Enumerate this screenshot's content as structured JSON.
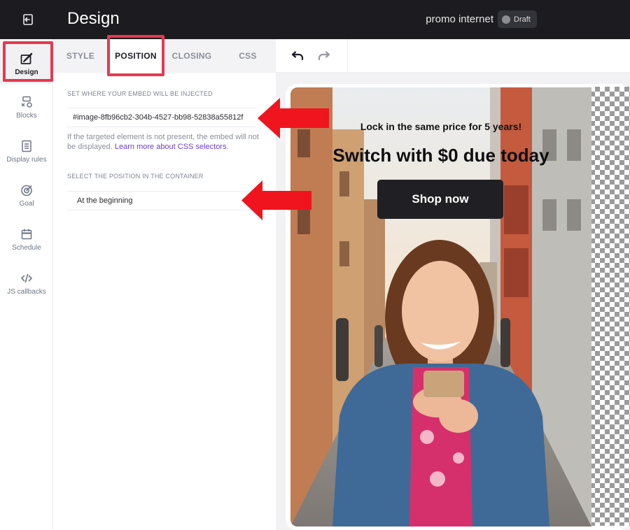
{
  "header": {
    "title": "Design",
    "campaign_name": "promo internet",
    "status_label": "Draft",
    "exit_icon": "exit-icon"
  },
  "sidebar": {
    "items": [
      {
        "label": "Design",
        "icon": "pen-icon",
        "active": true
      },
      {
        "label": "Blocks",
        "icon": "blocks-icon",
        "active": false
      },
      {
        "label": "Display rules",
        "icon": "document-icon",
        "active": false
      },
      {
        "label": "Goal",
        "icon": "target-icon",
        "active": false
      },
      {
        "label": "Schedule",
        "icon": "calendar-icon",
        "active": false
      },
      {
        "label": "JS callbacks",
        "icon": "code-icon",
        "active": false
      }
    ]
  },
  "panel": {
    "tabs": [
      {
        "label": "STYLE",
        "active": false
      },
      {
        "label": "POSITION",
        "active": true
      },
      {
        "label": "CLOSING",
        "active": false
      },
      {
        "label": "CSS",
        "active": false
      }
    ],
    "injection_label": "SET WHERE YOUR EMBED WILL BE INJECTED",
    "selector_value": "#image-8fb96cb2-304b-4527-bb98-52838a55812f",
    "help_text": "If the targeted element is not present, the embed will not be displayed.",
    "help_link": "Learn more about CSS selectors",
    "help_suffix": ".",
    "position_label": "SELECT THE POSITION IN THE CONTAINER",
    "position_value": "At the beginning"
  },
  "preview": {
    "undo_icon": "undo-icon",
    "redo_icon": "redo-icon",
    "banner": {
      "kicker": "Lock in the same price for 5 years!",
      "headline": "Switch with $0 due today",
      "cta": "Shop now"
    }
  },
  "colors": {
    "topbar": "#1c1c20",
    "annotation": "#e8384f",
    "arrow": "#f0141e",
    "link": "#6b3fd1",
    "cta_bg": "#202024"
  }
}
